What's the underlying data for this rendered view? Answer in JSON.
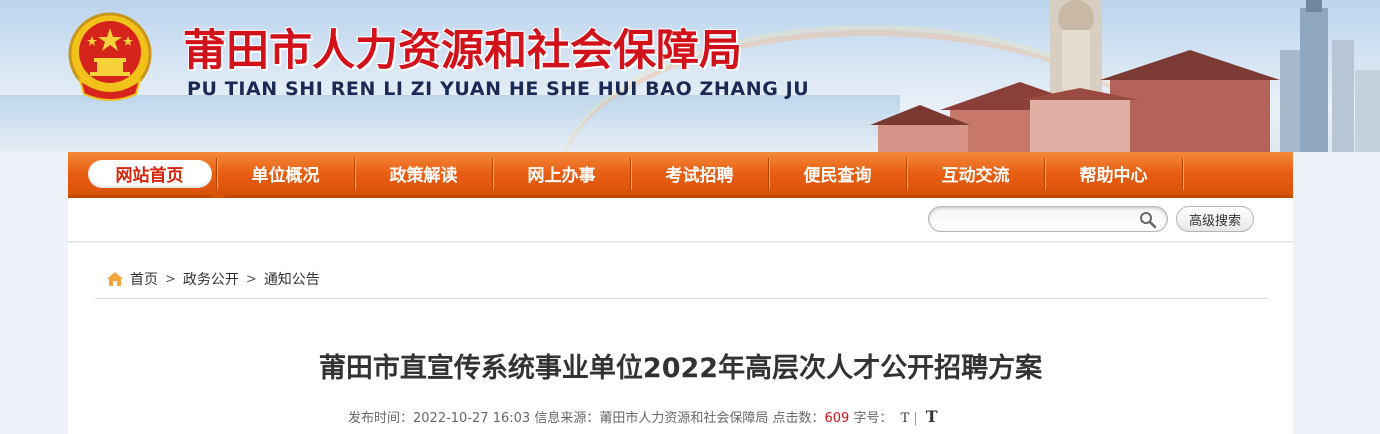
{
  "header": {
    "title": "莆田市人力资源和社会保障局",
    "pinyin": "PU TIAN SHI REN LI ZI YUAN HE SHE HUI BAO ZHANG JU",
    "emblem_icon": "national-emblem-icon"
  },
  "nav": {
    "items": [
      {
        "label": "网站首页",
        "active": true
      },
      {
        "label": "单位概况"
      },
      {
        "label": "政策解读"
      },
      {
        "label": "网上办事"
      },
      {
        "label": "考试招聘"
      },
      {
        "label": "便民查询"
      },
      {
        "label": "互动交流"
      },
      {
        "label": "帮助中心"
      }
    ]
  },
  "search": {
    "placeholder": "",
    "value": "",
    "advanced_label": "高级搜索"
  },
  "breadcrumb": {
    "items": [
      "首页",
      "政务公开",
      "通知公告"
    ],
    "separator": ">"
  },
  "article": {
    "title": "莆田市直宣传系统事业单位2022年高层次人才公开招聘方案",
    "publish_label": "发布时间：",
    "publish_time": "2022-10-27 16:03",
    "source_label": "信息来源：",
    "source": "莆田市人力资源和社会保障局",
    "clicks_label": "点击数：",
    "clicks": "609",
    "fontsize_label": "字号：",
    "font_small": "T",
    "font_separator": "|",
    "font_large": "T"
  },
  "colors": {
    "nav_orange": "#e85e12",
    "title_red": "#d2121b",
    "pinyin_navy": "#1b2a55"
  }
}
